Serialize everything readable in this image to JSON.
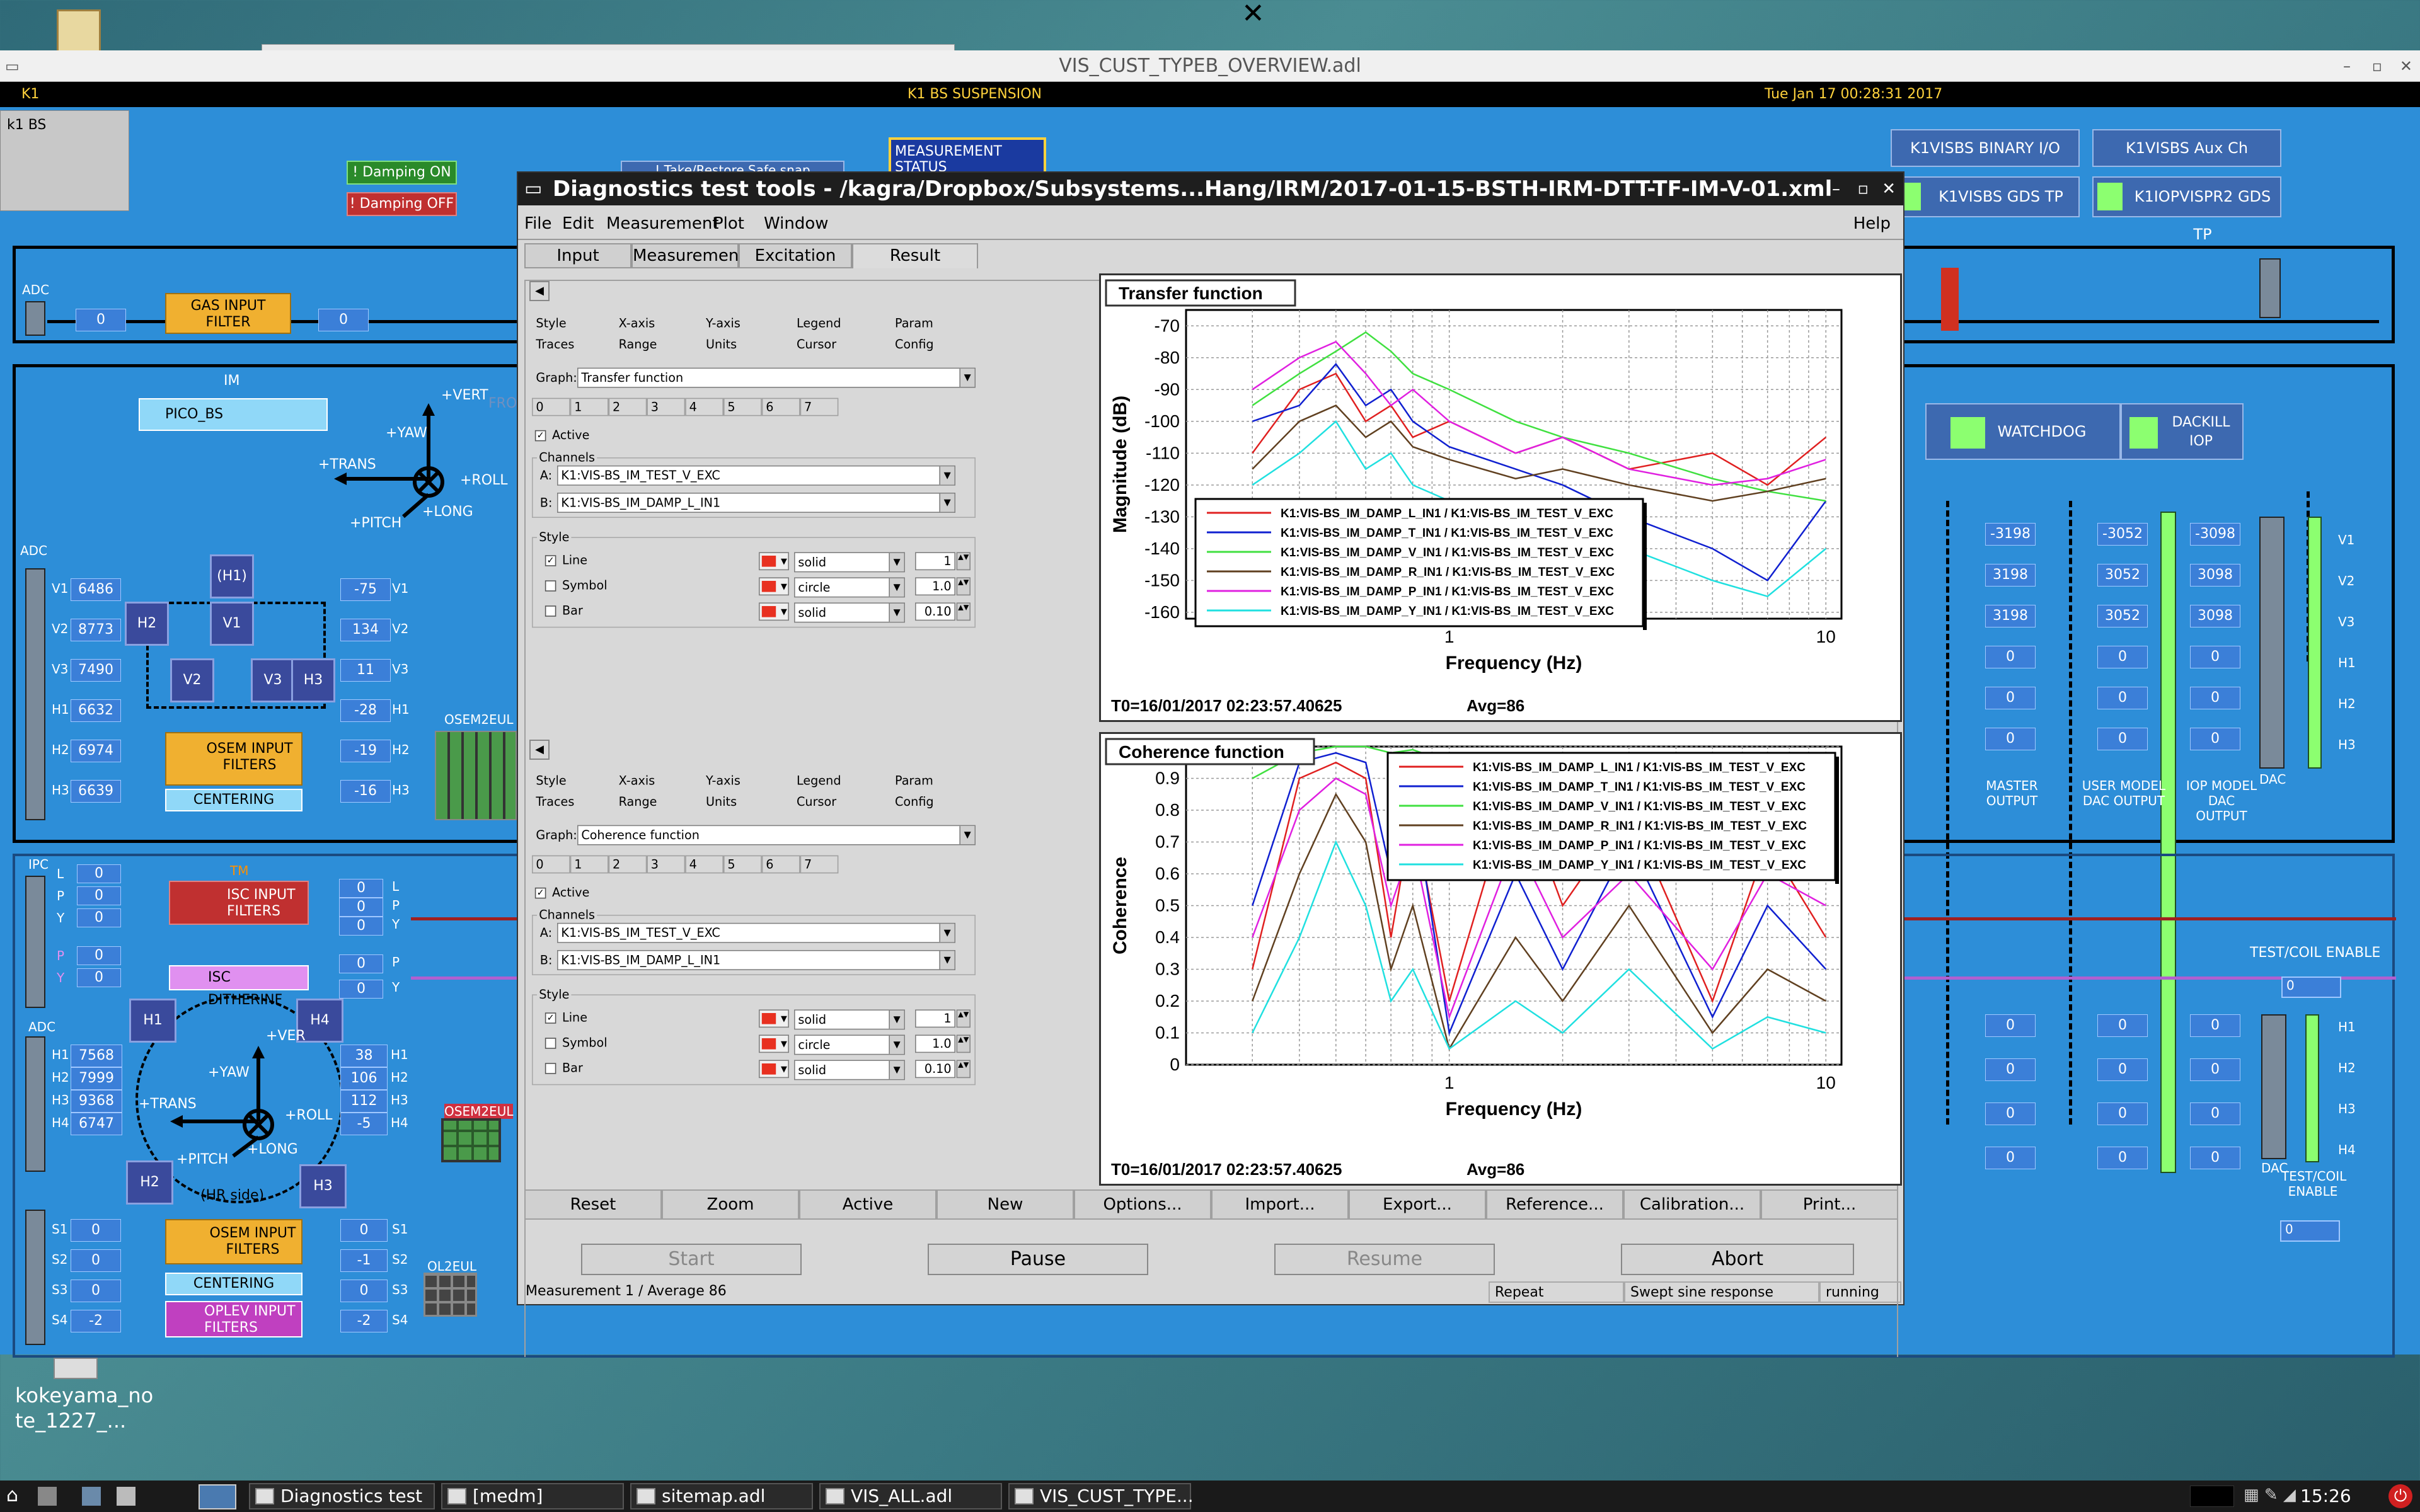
{
  "medm": {
    "title": "VIS_CUST_TYPEB_OVERVIEW.adl",
    "strip_left": "K1",
    "strip_center": "K1 BS SUSPENSION",
    "strip_right": "Tue Jan 17 00:28:31 2017",
    "k1bs": "k1 BS",
    "damping_on": "! Damping ON",
    "damping_off": "! Damping OFF",
    "measurement_status": "MEASUREMENT STATUS",
    "take_restore": "! Take/Restore Safe snap",
    "binary_io": "K1VISBS BINARY I/O",
    "aux_ch": "K1VISBS Aux Ch",
    "gds_tp": "K1VISBS GDS TP",
    "iop_gds_tp": "K1IOPVISPR2 GDS TP",
    "adc": "ADC",
    "gas_filter": "GAS INPUT FILTER",
    "gas_val_a": "0",
    "gas_val_b": "0",
    "im": "IM",
    "pico": "PICO_BS",
    "from": "FROM",
    "dirs_im": {
      "vert": "+VERT",
      "yaw": "+YAW",
      "trans": "+TRANS",
      "roll": "+ROLL",
      "long": "+LONG",
      "pitch": "+PITCH"
    },
    "adc_im_labels": [
      "V1",
      "V2",
      "V3",
      "H1",
      "H2",
      "H3"
    ],
    "adc_im_vals": [
      "6486",
      "8773",
      "7490",
      "6632",
      "6974",
      "6639"
    ],
    "osem_out_labels": [
      "V1",
      "V2",
      "V3",
      "H1",
      "H2",
      "H3"
    ],
    "osem_out_vals": [
      "-75",
      "134",
      "11",
      "-28",
      "-19",
      "-16"
    ],
    "im_nodes": {
      "h1": "(H1)",
      "h2": "H2",
      "v1": "V1",
      "v2": "V2",
      "v3": "V3",
      "h3": "H3"
    },
    "osem_filters": "OSEM INPUT FILTERS",
    "centering": "CENTERING",
    "osem2eul": "OSEM2EUL",
    "watchdog": "WATCHDOG",
    "dackill": "DACKILL IOP",
    "master_vals": [
      "-3198",
      "3198",
      "3198",
      "0",
      "0",
      "0"
    ],
    "user_vals": [
      "-3052",
      "3052",
      "3052",
      "0",
      "0",
      "0"
    ],
    "iop_vals": [
      "-3098",
      "3098",
      "3098",
      "0",
      "0",
      "0"
    ],
    "dac_labels": [
      "V1",
      "V2",
      "V3",
      "H1",
      "H2",
      "H3"
    ],
    "master_output": "MASTER OUTPUT",
    "user_model": "USER MODEL DAC OUTPUT",
    "iop_model": "IOP MODEL DAC OUTPUT",
    "dac": "DAC",
    "ipc": "IPC",
    "ipc_labels": [
      "L",
      "P",
      "Y",
      "P",
      "Y"
    ],
    "ipc_vals": [
      "0",
      "0",
      "0",
      "0",
      "0"
    ],
    "isc_filters": "ISC INPUT FILTERS",
    "isc_dither": "ISC DITHERINF",
    "tm": "TM",
    "isc_out_labels": [
      "L",
      "P",
      "Y",
      "P",
      "Y"
    ],
    "isc_out_vals": [
      "0",
      "0",
      "0",
      "0",
      "0"
    ],
    "adc_tm_labels": [
      "H1",
      "H2",
      "H3",
      "H4"
    ],
    "adc_tm_vals": [
      "7568",
      "7999",
      "9368",
      "6747"
    ],
    "tm_out_labels": [
      "H1",
      "H2",
      "H3",
      "H4"
    ],
    "tm_out_vals": [
      "38",
      "106",
      "112",
      "-5"
    ],
    "tm_nodes": {
      "h1": "H1",
      "h4": "H4",
      "h2": "H2",
      "h3": "H3"
    },
    "dirs_tm": {
      "ver": "+VER",
      "yaw": "+YAW",
      "trans": "+TRANS",
      "roll": "+ROLL",
      "long": "+LONG",
      "pitch": "+PITCH"
    },
    "hr_side": "(HR side)",
    "s_labels": [
      "S1",
      "S2",
      "S3",
      "S4"
    ],
    "s_vals": [
      "0",
      "0",
      "0",
      "-2"
    ],
    "s_out_labels": [
      "S1",
      "S2",
      "S3",
      "S4"
    ],
    "s_out_vals": [
      "0",
      "-1",
      "0",
      "-2"
    ],
    "oplev_filters": "OPLEV INPUT FILTERS",
    "ol2eul": "OL2EUL",
    "osem2eul2": "OSEM2EUL",
    "test_coil": "TEST/COIL ENABLE",
    "test_coil2": "TEST/COIL ENABLE",
    "test_coil_val": "0",
    "test_coil_val2": "0",
    "dac_tm_labels": [
      "H1",
      "H2",
      "H3",
      "H4"
    ],
    "tm_dac_vals": [
      "0",
      "0",
      "0",
      "0"
    ]
  },
  "diag": {
    "title": "Diagnostics test tools - /kagra/Dropbox/Subsystems...Hang/IRM/2017-01-15-BSTH-IRM-DTT-TF-IM-V-01.xml",
    "menu": [
      "File",
      "Edit",
      "Measurement",
      "Plot",
      "Window"
    ],
    "help": "Help",
    "tabs": [
      "Input",
      "Measurement",
      "Excitation",
      "Result"
    ],
    "style_tabs_row1": [
      "Style",
      "X-axis",
      "Y-axis",
      "Legend",
      "Param"
    ],
    "style_tabs_row2": [
      "Traces",
      "Range",
      "Units",
      "Cursor",
      "Config"
    ],
    "graph_label": "Graph:",
    "trace_nums": [
      "0",
      "1",
      "2",
      "3",
      "4",
      "5",
      "6",
      "7"
    ],
    "active": "Active",
    "channels": "Channels",
    "style": "Style",
    "a_label": "A:",
    "b_label": "B:",
    "line": "Line",
    "symbol": "Symbol",
    "bar": "Bar",
    "panel1": {
      "graph": "Transfer function",
      "chan_a": "K1:VIS-BS_IM_TEST_V_EXC",
      "chan_b": "K1:VIS-BS_IM_DAMP_L_IN1",
      "line_style": "solid",
      "line_w": "1",
      "sym_style": "circle",
      "sym_w": "1.0",
      "bar_style": "solid",
      "bar_w": "0.10"
    },
    "panel2": {
      "graph": "Coherence function",
      "chan_a": "K1:VIS-BS_IM_TEST_V_EXC",
      "chan_b": "K1:VIS-BS_IM_DAMP_L_IN1",
      "line_style": "solid",
      "line_w": "1",
      "sym_style": "circle",
      "sym_w": "1.0",
      "bar_style": "solid",
      "bar_w": "0.10"
    },
    "bottom_buttons": [
      "Reset",
      "Zoom",
      "Active",
      "New",
      "Options...",
      "Import...",
      "Export...",
      "Reference...",
      "Calibration...",
      "Print..."
    ],
    "start": "Start",
    "pause": "Pause",
    "resume": "Resume",
    "abort": "Abort",
    "status_left": "Measurement 1 / Average 86",
    "status_repeat": "Repeat",
    "status_type": "Swept sine response",
    "status_state": "running"
  },
  "chart_data": [
    {
      "type": "line",
      "title": "Transfer function",
      "xlabel": "Frequency (Hz)",
      "ylabel": "Magnitude (dB)",
      "xscale": "log",
      "xlim": [
        0.2,
        11
      ],
      "ylim": [
        -162,
        -65
      ],
      "yticks": [
        "-70",
        "-80",
        "-90",
        "-100",
        "-110",
        "-120",
        "-130",
        "-140",
        "-150",
        "-160"
      ],
      "xticks": [
        "1",
        "10"
      ],
      "footer_t0": "T0=16/01/2017 02:23:57.40625",
      "footer_avg": "Avg=86",
      "legend_position": "center-left",
      "grid": true,
      "series": [
        {
          "name": "K1:VIS-BS_IM_DAMP_L_IN1 / K1:VIS-BS_IM_TEST_V_EXC",
          "color": "#e02020",
          "x": [
            0.3,
            0.4,
            0.5,
            0.6,
            0.7,
            0.8,
            1,
            1.5,
            2,
            3,
            5,
            7,
            10
          ],
          "y": [
            -110,
            -90,
            -85,
            -100,
            -95,
            -105,
            -100,
            -110,
            -105,
            -115,
            -110,
            -120,
            -105
          ]
        },
        {
          "name": "K1:VIS-BS_IM_DAMP_T_IN1 / K1:VIS-BS_IM_TEST_V_EXC",
          "color": "#1020d0",
          "x": [
            0.3,
            0.4,
            0.5,
            0.6,
            0.7,
            0.8,
            1,
            1.5,
            2,
            3,
            5,
            7,
            10
          ],
          "y": [
            -100,
            -95,
            -82,
            -95,
            -90,
            -100,
            -108,
            -115,
            -120,
            -130,
            -140,
            -150,
            -125
          ]
        },
        {
          "name": "K1:VIS-BS_IM_DAMP_V_IN1 / K1:VIS-BS_IM_TEST_V_EXC",
          "color": "#40e040",
          "x": [
            0.3,
            0.4,
            0.5,
            0.6,
            0.7,
            0.8,
            1,
            1.5,
            2,
            3,
            5,
            7,
            10
          ],
          "y": [
            -95,
            -85,
            -78,
            -72,
            -78,
            -85,
            -90,
            -100,
            -105,
            -110,
            -118,
            -122,
            -125
          ]
        },
        {
          "name": "K1:VIS-BS_IM_DAMP_R_IN1 / K1:VIS-BS_IM_TEST_V_EXC",
          "color": "#604020",
          "x": [
            0.3,
            0.4,
            0.5,
            0.6,
            0.7,
            0.8,
            1,
            1.5,
            2,
            3,
            5,
            7,
            10
          ],
          "y": [
            -115,
            -100,
            -95,
            -105,
            -100,
            -108,
            -112,
            -118,
            -115,
            -120,
            -125,
            -122,
            -118
          ]
        },
        {
          "name": "K1:VIS-BS_IM_DAMP_P_IN1 / K1:VIS-BS_IM_TEST_V_EXC",
          "color": "#e020e0",
          "x": [
            0.3,
            0.4,
            0.5,
            0.6,
            0.7,
            0.8,
            1,
            1.5,
            2,
            3,
            5,
            7,
            10
          ],
          "y": [
            -90,
            -80,
            -75,
            -85,
            -95,
            -90,
            -100,
            -110,
            -105,
            -115,
            -120,
            -118,
            -112
          ]
        },
        {
          "name": "K1:VIS-BS_IM_DAMP_Y_IN1 / K1:VIS-BS_IM_TEST_V_EXC",
          "color": "#20e0e0",
          "x": [
            0.3,
            0.4,
            0.5,
            0.6,
            0.7,
            0.8,
            1,
            1.5,
            2,
            3,
            5,
            7,
            10
          ],
          "y": [
            -120,
            -110,
            -100,
            -115,
            -110,
            -120,
            -125,
            -130,
            -135,
            -140,
            -150,
            -155,
            -140
          ]
        }
      ]
    },
    {
      "type": "line",
      "title": "Coherence function",
      "xlabel": "Frequency (Hz)",
      "ylabel": "Coherence",
      "xscale": "log",
      "xlim": [
        0.2,
        11
      ],
      "ylim": [
        0,
        1
      ],
      "yticks": [
        "1",
        "0.9",
        "0.8",
        "0.7",
        "0.6",
        "0.5",
        "0.4",
        "0.3",
        "0.2",
        "0.1",
        "0"
      ],
      "xticks": [
        "1",
        "10"
      ],
      "footer_t0": "T0=16/01/2017 02:23:57.40625",
      "footer_avg": "Avg=86",
      "legend_position": "top-right",
      "grid": true,
      "series": [
        {
          "name": "K1:VIS-BS_IM_DAMP_L_IN1 / K1:VIS-BS_IM_TEST_V_EXC",
          "color": "#e02020",
          "x": [
            0.3,
            0.4,
            0.5,
            0.6,
            0.7,
            0.8,
            1,
            1.5,
            2,
            3,
            5,
            7,
            10
          ],
          "y": [
            0.3,
            0.9,
            0.95,
            0.9,
            0.4,
            0.8,
            0.2,
            0.9,
            0.5,
            0.8,
            0.2,
            0.7,
            0.4
          ]
        },
        {
          "name": "K1:VIS-BS_IM_DAMP_T_IN1 / K1:VIS-BS_IM_TEST_V_EXC",
          "color": "#1020d0",
          "x": [
            0.3,
            0.4,
            0.5,
            0.6,
            0.7,
            0.8,
            1,
            1.5,
            2,
            3,
            5,
            7,
            10
          ],
          "y": [
            0.5,
            0.95,
            0.98,
            0.95,
            0.6,
            0.85,
            0.1,
            0.6,
            0.3,
            0.7,
            0.15,
            0.5,
            0.3
          ]
        },
        {
          "name": "K1:VIS-BS_IM_DAMP_V_IN1 / K1:VIS-BS_IM_TEST_V_EXC",
          "color": "#40e040",
          "x": [
            0.3,
            0.4,
            0.5,
            0.6,
            0.7,
            0.8,
            1,
            1.5,
            2,
            3,
            5,
            7,
            10
          ],
          "y": [
            0.9,
            0.98,
            1,
            1,
            0.98,
            0.99,
            0.95,
            0.97,
            0.9,
            0.95,
            0.85,
            0.9,
            0.8
          ]
        },
        {
          "name": "K1:VIS-BS_IM_DAMP_R_IN1 / K1:VIS-BS_IM_TEST_V_EXC",
          "color": "#604020",
          "x": [
            0.3,
            0.4,
            0.5,
            0.6,
            0.7,
            0.8,
            1,
            1.5,
            2,
            3,
            5,
            7,
            10
          ],
          "y": [
            0.2,
            0.6,
            0.85,
            0.7,
            0.3,
            0.5,
            0.05,
            0.4,
            0.2,
            0.5,
            0.1,
            0.3,
            0.2
          ]
        },
        {
          "name": "K1:VIS-BS_IM_DAMP_P_IN1 / K1:VIS-BS_IM_TEST_V_EXC",
          "color": "#e020e0",
          "x": [
            0.3,
            0.4,
            0.5,
            0.6,
            0.7,
            0.8,
            1,
            1.5,
            2,
            3,
            5,
            7,
            10
          ],
          "y": [
            0.4,
            0.8,
            0.9,
            0.85,
            0.5,
            0.7,
            0.15,
            0.7,
            0.4,
            0.6,
            0.3,
            0.6,
            0.5
          ]
        },
        {
          "name": "K1:VIS-BS_IM_DAMP_Y_IN1 / K1:VIS-BS_IM_TEST_V_EXC",
          "color": "#20e0e0",
          "x": [
            0.3,
            0.4,
            0.5,
            0.6,
            0.7,
            0.8,
            1,
            1.5,
            2,
            3,
            5,
            7,
            10
          ],
          "y": [
            0.1,
            0.4,
            0.7,
            0.5,
            0.2,
            0.3,
            0.05,
            0.2,
            0.1,
            0.3,
            0.05,
            0.15,
            0.1
          ]
        }
      ]
    }
  ],
  "desktop": {
    "label": "kokeyama_note_1227_...",
    "clock": "15:26"
  },
  "taskbar": {
    "tasks": [
      "Diagnostics test ...",
      "[medm]",
      "sitemap.adl",
      "VIS_ALL.adl",
      "VIS_CUST_TYPE..."
    ]
  },
  "colors": {
    "medm_bg": "#2d8ed8",
    "plot_bg": "#ffffff",
    "accent_green": "#8cff70"
  }
}
